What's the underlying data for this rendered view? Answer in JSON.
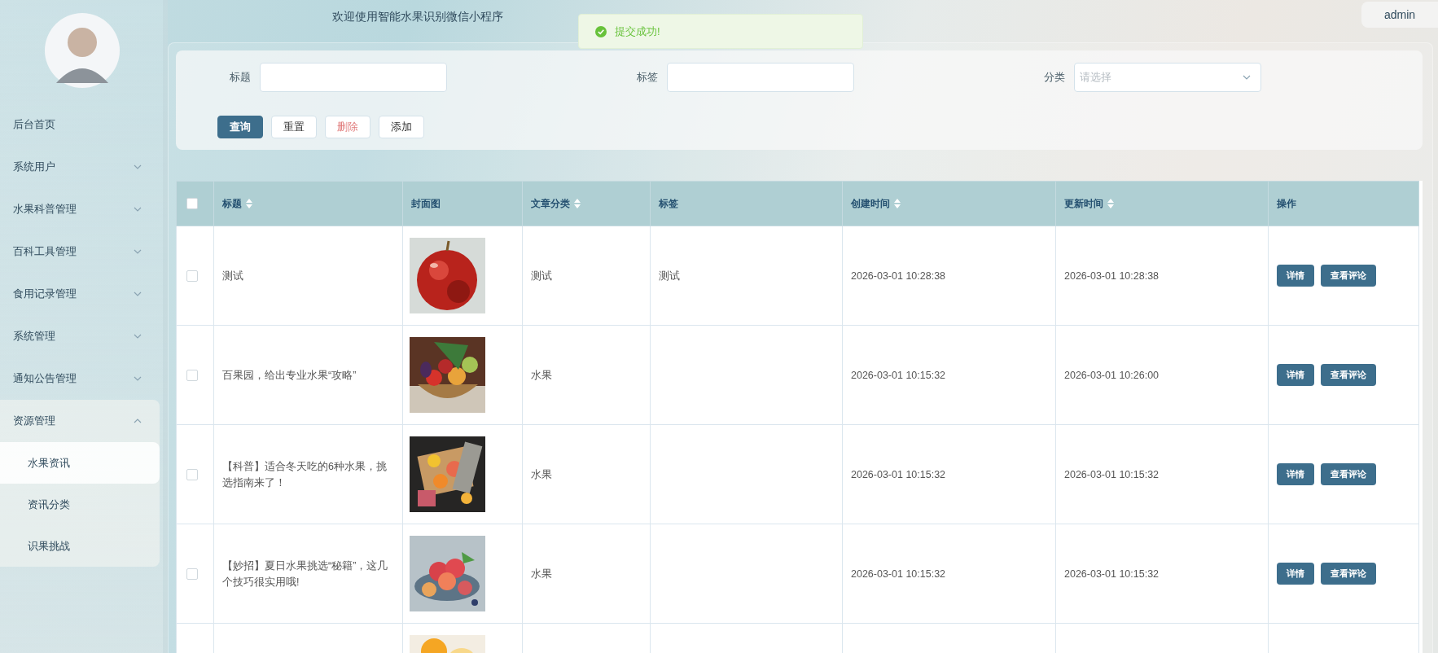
{
  "sidebar": {
    "items": [
      {
        "label": "后台首页",
        "kind": "link"
      },
      {
        "label": "系统用户",
        "kind": "submenu",
        "expanded": false
      },
      {
        "label": "水果科普管理",
        "kind": "submenu",
        "expanded": false
      },
      {
        "label": "百科工具管理",
        "kind": "submenu",
        "expanded": false
      },
      {
        "label": "食用记录管理",
        "kind": "submenu",
        "expanded": false
      },
      {
        "label": "系统管理",
        "kind": "submenu",
        "expanded": false
      },
      {
        "label": "通知公告管理",
        "kind": "submenu",
        "expanded": false
      },
      {
        "label": "资源管理",
        "kind": "submenu",
        "expanded": true,
        "children": [
          {
            "label": "水果资讯",
            "selected": true
          },
          {
            "label": "资讯分类",
            "selected": false
          },
          {
            "label": "识果挑战",
            "selected": false
          }
        ]
      }
    ]
  },
  "header": {
    "title": "欢迎使用智能水果识别微信小程序",
    "user": "admin"
  },
  "toast": {
    "text": "提交成功!",
    "kind": "success"
  },
  "search": {
    "fields": [
      {
        "label": "标题",
        "kind": "input"
      },
      {
        "label": "标签",
        "kind": "input"
      },
      {
        "label": "分类",
        "kind": "select",
        "placeholder": "请选择"
      }
    ],
    "buttons": [
      {
        "label": "查询",
        "kind": "primary"
      },
      {
        "label": "重置",
        "kind": "plain"
      },
      {
        "label": "删除",
        "kind": "danger"
      },
      {
        "label": "添加",
        "kind": "plain"
      }
    ]
  },
  "table": {
    "header_checked": false,
    "columns": [
      {
        "label": "标题",
        "sortable": true
      },
      {
        "label": "封面图",
        "sortable": false
      },
      {
        "label": "文章分类",
        "sortable": true
      },
      {
        "label": "标签",
        "sortable": false
      },
      {
        "label": "创建时间",
        "sortable": true
      },
      {
        "label": "更新时间",
        "sortable": true
      },
      {
        "label": "操作",
        "sortable": false
      }
    ],
    "rows": [
      {
        "checked": false,
        "title": "测试",
        "cover": {
          "kind": "picture"
        },
        "category": "测试",
        "tag": "测试",
        "created": "2026-03-01 10:28:38",
        "updated": "2026-03-01 10:28:38",
        "actions": [
          "详情",
          "查看评论"
        ]
      },
      {
        "checked": false,
        "title": "百果园，给出专业水果“攻略”",
        "cover": {
          "kind": "picture"
        },
        "category": "水果",
        "created": "2026-03-01 10:15:32",
        "updated": "2026-03-01 10:26:00",
        "actions": [
          "详情",
          "查看评论"
        ]
      },
      {
        "checked": false,
        "title": "【科普】适合冬天吃的6种水果，挑选指南来了！",
        "cover": {
          "kind": "picture"
        },
        "category": "水果",
        "created": "2026-03-01 10:15:32",
        "updated": "2026-03-01 10:15:32",
        "actions": [
          "详情",
          "查看评论"
        ]
      },
      {
        "checked": false,
        "title": "【妙招】夏日水果挑选“秘籍”，这几个技巧很实用哦!",
        "cover": {
          "kind": "picture"
        },
        "category": "水果",
        "created": "2026-03-01 10:15:32",
        "updated": "2026-03-01 10:15:32",
        "actions": [
          "详情",
          "查看评论"
        ]
      },
      {
        "cover": {
          "kind": "picture"
        }
      }
    ]
  }
}
